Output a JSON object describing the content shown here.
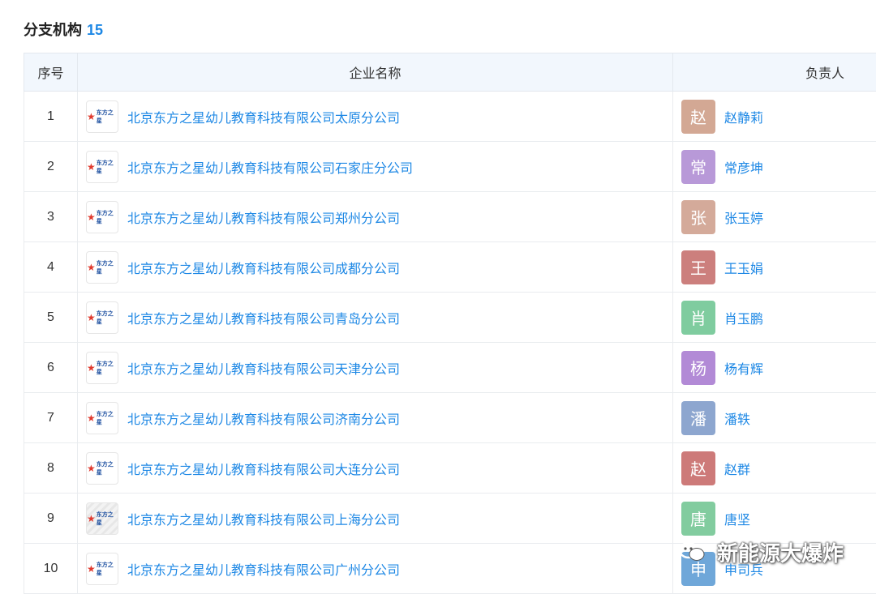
{
  "section": {
    "title": "分支机构",
    "count": "15"
  },
  "table": {
    "headers": [
      "序号",
      "企业名称",
      "负责人"
    ],
    "rows": [
      {
        "index": "1",
        "company": "北京东方之星幼儿教育科技有限公司太原分公司",
        "avatar_char": "赵",
        "avatar_color": "#d3a894",
        "person": "赵静莉"
      },
      {
        "index": "2",
        "company": "北京东方之星幼儿教育科技有限公司石家庄分公司",
        "avatar_char": "常",
        "avatar_color": "#b899d8",
        "person": "常彦坤"
      },
      {
        "index": "3",
        "company": "北京东方之星幼儿教育科技有限公司郑州分公司",
        "avatar_char": "张",
        "avatar_color": "#d4aa9a",
        "person": "张玉婷"
      },
      {
        "index": "4",
        "company": "北京东方之星幼儿教育科技有限公司成都分公司",
        "avatar_char": "王",
        "avatar_color": "#cc7f7d",
        "person": "王玉娟"
      },
      {
        "index": "5",
        "company": "北京东方之星幼儿教育科技有限公司青岛分公司",
        "avatar_char": "肖",
        "avatar_color": "#7fcc9f",
        "person": "肖玉鹏"
      },
      {
        "index": "6",
        "company": "北京东方之星幼儿教育科技有限公司天津分公司",
        "avatar_char": "杨",
        "avatar_color": "#b28ad6",
        "person": "杨有辉"
      },
      {
        "index": "7",
        "company": "北京东方之星幼儿教育科技有限公司济南分公司",
        "avatar_char": "潘",
        "avatar_color": "#8da6cf",
        "person": "潘轶"
      },
      {
        "index": "8",
        "company": "北京东方之星幼儿教育科技有限公司大连分公司",
        "avatar_char": "赵",
        "avatar_color": "#cd7a79",
        "person": "赵群"
      },
      {
        "index": "9",
        "company": "北京东方之星幼儿教育科技有限公司上海分公司",
        "avatar_char": "唐",
        "avatar_color": "#82cc9f",
        "person": "唐坚"
      },
      {
        "index": "10",
        "company": "北京东方之星幼儿教育科技有限公司广州分公司",
        "avatar_char": "申",
        "avatar_color": "#6fa7d9",
        "person": "申司兵"
      }
    ]
  },
  "logo_text": "东方之星",
  "watermark": {
    "text": "新能源大爆炸",
    "icon": "wechat-icon"
  }
}
